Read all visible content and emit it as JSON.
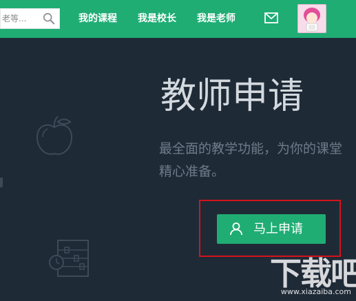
{
  "topbar": {
    "search": {
      "placeholder": "老等...",
      "icon": "search-icon"
    },
    "nav": [
      {
        "label": "我的课程"
      },
      {
        "label": "我是校长"
      },
      {
        "label": "我是老师"
      }
    ],
    "mail_icon": "mail-icon",
    "avatar": "avatar"
  },
  "hero": {
    "title": "教师申请",
    "subtitle": "最全面的教学功能，为你的课堂精心准备。",
    "apply_button": {
      "label": "马上申请",
      "icon": "user-icon"
    }
  },
  "watermark": {
    "text": "下载吧",
    "small": "www.xiazaiba.com"
  },
  "colors": {
    "brand_green": "#1fad74",
    "background": "#1f2a37",
    "title_text": "#d3d9de",
    "subtitle_text": "#6d7c89",
    "highlight_red": "#d6131b"
  }
}
